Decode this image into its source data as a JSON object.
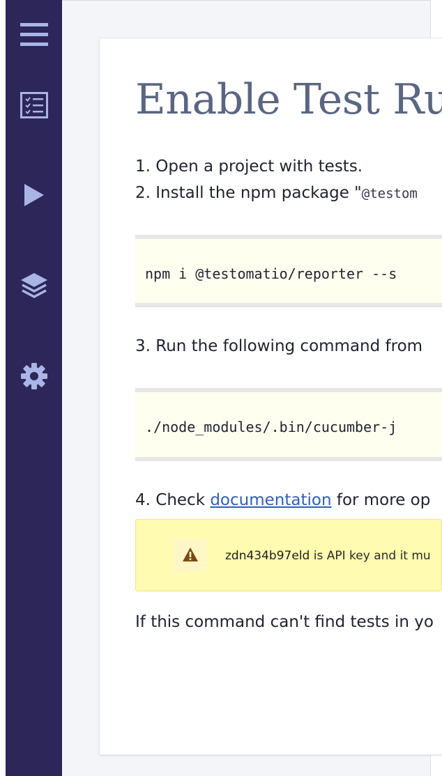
{
  "sidebar": {
    "items": [
      {
        "icon": "hamburger-menu-icon"
      },
      {
        "icon": "checklist-icon"
      },
      {
        "icon": "play-icon"
      },
      {
        "icon": "layers-icon"
      },
      {
        "icon": "gear-icon"
      }
    ]
  },
  "main": {
    "title": "Enable Test Ru",
    "step1": "1. Open a project with tests.",
    "step2_prefix": "2. Install the npm package \"",
    "step2_package": "@testom",
    "code1": "npm i @testomatio/reporter --s",
    "step3": "3. Run the following command from",
    "code2": "./node_modules/.bin/cucumber-j",
    "step4_prefix": "4. Check ",
    "step4_link": "documentation",
    "step4_suffix": " for more op",
    "alert": {
      "icon": "warning-icon",
      "key": "zdn434b97eld",
      "text": " is API key and it mu"
    },
    "footer_text": "If this command can't find tests in yo"
  },
  "colors": {
    "sidebar_bg": "#2d2658",
    "sidebar_icon": "#a9b5e6",
    "title": "#5a6681",
    "link": "#2f5fb3",
    "code_bg": "#fffff0",
    "alert_bg": "#fffbb0",
    "warning_icon": "#7a4a12"
  }
}
